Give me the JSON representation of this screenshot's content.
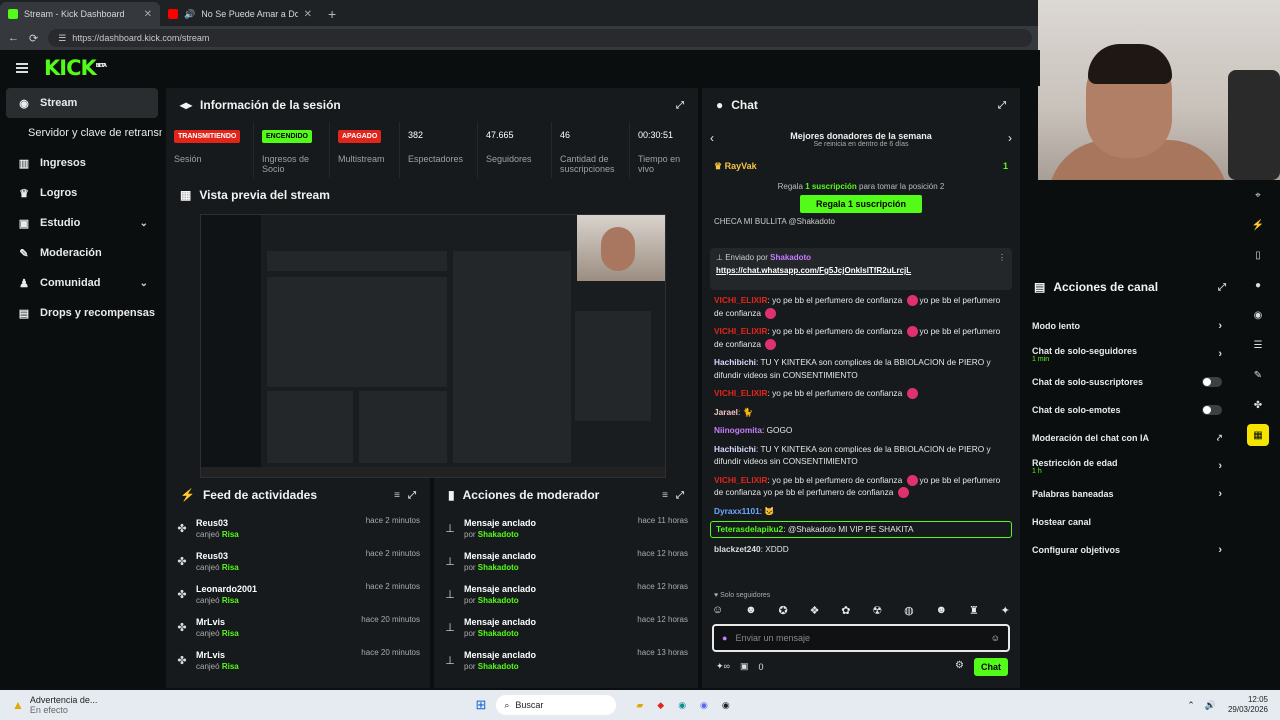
{
  "browser": {
    "tabs": [
      {
        "title": "Stream - Kick Dashboard",
        "active": true
      },
      {
        "title": "No Se Puede Amar a Dos - Yo",
        "active": false
      }
    ],
    "url": "https://dashboard.kick.com/stream"
  },
  "brand": {
    "logo": "KICK",
    "tag": "BETA",
    "accent": "#53fc18"
  },
  "sidebar": {
    "items": [
      {
        "label": "Stream",
        "icon": "broadcast-icon"
      },
      {
        "label": "Servidor y clave de retransmisión",
        "icon": ""
      },
      {
        "label": "Ingresos",
        "icon": "bar-chart-icon"
      },
      {
        "label": "Logros",
        "icon": "trophy-icon"
      },
      {
        "label": "Estudio",
        "icon": "studio-icon"
      },
      {
        "label": "Moderación",
        "icon": "wrench-icon"
      },
      {
        "label": "Comunidad",
        "icon": "users-icon"
      },
      {
        "label": "Drops y recompensas",
        "icon": "gift-icon"
      }
    ]
  },
  "session": {
    "title": "Información de la sesión",
    "stats": [
      {
        "value": "TRANSMITIENDO",
        "label": "Sesión"
      },
      {
        "value": "ENCENDIDO",
        "label": "Ingresos de Socio"
      },
      {
        "value": "APAGADO",
        "label": "Multistream"
      },
      {
        "value": "382",
        "label": "Espectadores"
      },
      {
        "value": "47.665",
        "label": "Seguidores"
      },
      {
        "value": "46",
        "label": "Cantidad de suscripciones"
      },
      {
        "value": "00:30:51",
        "label": "Tiempo en vivo"
      }
    ]
  },
  "preview": {
    "title": "Vista previa del stream"
  },
  "feed": {
    "title": "Feed de actividades",
    "rows": [
      {
        "user": "Reus03",
        "action": "canjeó",
        "item": "Risa",
        "time": "hace 2 minutos"
      },
      {
        "user": "Reus03",
        "action": "canjeó",
        "item": "Risa",
        "time": "hace 2 minutos"
      },
      {
        "user": "Leonardo2001",
        "action": "canjeó",
        "item": "Risa",
        "time": "hace 2 minutos"
      },
      {
        "user": "MrLvis",
        "action": "canjeó",
        "item": "Risa",
        "time": "hace 20 minutos"
      },
      {
        "user": "MrLvis",
        "action": "canjeó",
        "item": "Risa",
        "time": "hace 20 minutos"
      }
    ]
  },
  "modactions": {
    "title": "Acciones de moderador",
    "rows": [
      {
        "action": "Mensaje anclado",
        "by": "por",
        "user": "Shakadoto",
        "time": "hace 11 horas"
      },
      {
        "action": "Mensaje anclado",
        "by": "por",
        "user": "Shakadoto",
        "time": "hace 12 horas"
      },
      {
        "action": "Mensaje anclado",
        "by": "por",
        "user": "Shakadoto",
        "time": "hace 12 horas"
      },
      {
        "action": "Mensaje anclado",
        "by": "por",
        "user": "Shakadoto",
        "time": "hace 12 horas"
      },
      {
        "action": "Mensaje anclado",
        "by": "por",
        "user": "Shakadoto",
        "time": "hace 13 horas"
      }
    ]
  },
  "chat": {
    "title": "Chat",
    "donors_title": "Mejores donadores de la semana",
    "donors_sub": "Se reinicia en dentro de 6 días",
    "top_donor": "RayVak",
    "top_donor_count": "1",
    "gift_text_pre": "Regala",
    "gift_text_sub": "1 suscripción",
    "gift_text_post": "para tomar la posición 2",
    "gift_button": "Regala 1 suscripción",
    "clipped_line": "CHECA MI BULLITA @Shakadoto",
    "pinned_by": "Enviado por",
    "pinned_user": "Shakadoto",
    "pinned_link": "https://chat.whatsapp.com/Fg5JcjOnklsITfR2uLrcjL",
    "messages": [
      {
        "user": "VICHI_ELIXIR",
        "color": "#e1251b",
        "text": "yo pe bb el perfumero de confianza",
        "tail": "yo pe bb el perfumero de confianza"
      },
      {
        "user": "VICHI_ELIXIR",
        "color": "#e1251b",
        "text": "yo pe bb el perfumero de confianza",
        "tail": "yo pe bb el perfumero de confianza"
      },
      {
        "user": "Hachibichi",
        "color": "#d9d9ff",
        "text": "TU Y KINTEKA son complices de la BBIOLACION de PIERO y difundir videos sin CONSENTIMIENTO",
        "tail": ""
      },
      {
        "user": "VICHI_ELIXIR",
        "color": "#e1251b",
        "text": "yo pe bb el perfumero de confianza",
        "tail": ""
      },
      {
        "user": "Jarael",
        "color": "#f1c2c2",
        "text": "",
        "tail": ""
      },
      {
        "user": "Niinogomita",
        "color": "#c57cff",
        "text": "GOGO",
        "tail": ""
      },
      {
        "user": "Hachibichi",
        "color": "#d9d9ff",
        "text": "TU Y KINTEKA son complices de la BBIOLACION de PIERO y difundir videos sin CONSENTIMIENTO",
        "tail": ""
      },
      {
        "user": "VICHI_ELIXIR",
        "color": "#e1251b",
        "text": "yo pe bb el perfumero de confianza",
        "tail": "yo pe bb el perfumero de confianza yo pe bb el perfumero de confianza"
      },
      {
        "user": "Dyraxx1101",
        "color": "#6fa8ff",
        "text": "",
        "tail": ""
      },
      {
        "user": "Teterasdelapiku2",
        "color": "#53fc18",
        "text": "@Shakadoto MI VIP PE SHAKITA",
        "tail": ""
      },
      {
        "user": "blackzet240",
        "color": "#dddddd",
        "text": "XDDD",
        "tail": ""
      }
    ],
    "followers_only": "Solo seguidores",
    "input_placeholder": "Enviar un mensaje",
    "points": "0",
    "send_label": "Chat"
  },
  "channel_actions": {
    "title": "Acciones de canal",
    "rows": [
      {
        "label": "Modo lento",
        "sub": "",
        "control": "chevron"
      },
      {
        "label": "Chat de solo-seguidores",
        "sub": "1 min",
        "control": "chevron"
      },
      {
        "label": "Chat de solo-suscriptores",
        "sub": "",
        "control": "toggle"
      },
      {
        "label": "Chat de solo-emotes",
        "sub": "",
        "control": "toggle"
      },
      {
        "label": "Moderación del chat con IA",
        "sub": "",
        "control": "external"
      },
      {
        "label": "Restricción de edad",
        "sub": "1 h",
        "control": "chevron"
      },
      {
        "label": "Palabras baneadas",
        "sub": "",
        "control": "chevron"
      },
      {
        "label": "Hostear canal",
        "sub": "",
        "control": "none"
      },
      {
        "label": "Configurar objetivos",
        "sub": "",
        "control": "chevron"
      }
    ]
  },
  "taskbar": {
    "alert_title": "Advertencia de...",
    "alert_sub": "En efecto",
    "search": "Buscar",
    "time": "12:05",
    "date": "29/03/2026"
  }
}
